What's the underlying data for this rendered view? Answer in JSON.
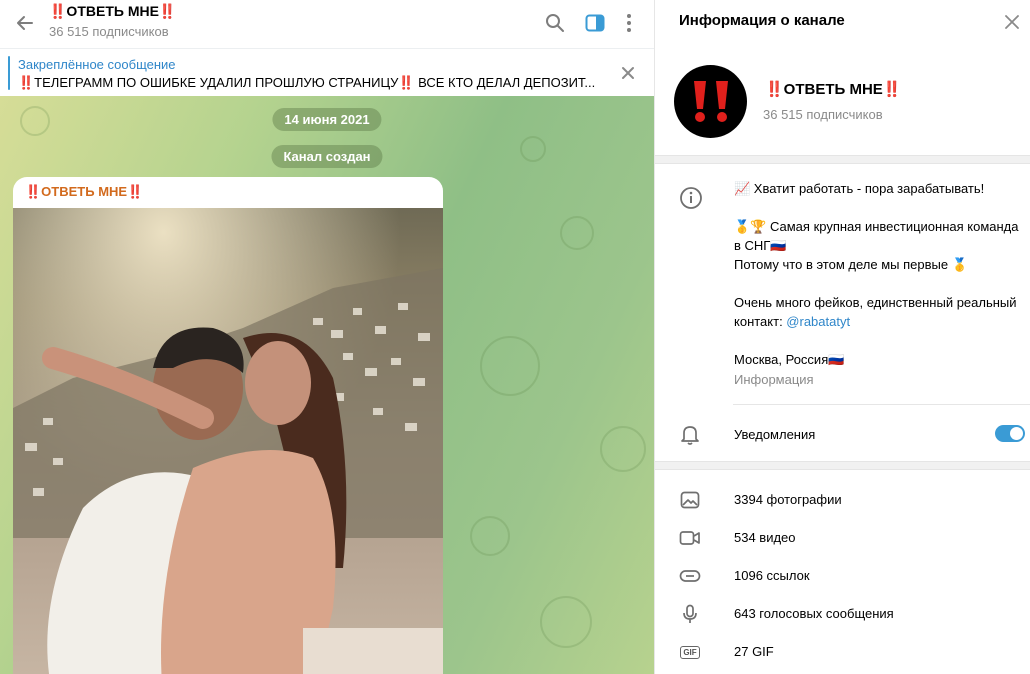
{
  "header": {
    "title": "‼️ОТВЕТЬ МНЕ‼️",
    "subscribers": "36 515 подписчиков"
  },
  "pinned": {
    "label": "Закреплённое сообщение",
    "text": "‼️ТЕЛЕГРАММ ПО ОШИБКЕ УДАЛИЛ ПРОШЛУЮ СТРАНИЦУ‼️  ВСЕ КТО ДЕЛАЛ ДЕПОЗИТ..."
  },
  "chat": {
    "date_pill": "14 июня 2021",
    "service_pill": "Канал создан",
    "message_author": "‼️ОТВЕТЬ МНЕ‼️"
  },
  "info": {
    "panel_title": "Информация о канале",
    "channel_name": "‼️ОТВЕТЬ МНЕ‼️",
    "subscribers": "36 515 подписчиков",
    "description": [
      "📈 Хватит работать - пора зарабатывать!",
      "",
      "🥇🏆 Самая крупная инвестиционная команда в СНГ🇷🇺",
      "Потому что в этом деле мы первые 🥇",
      "",
      "Очень много фейков, единственный реальный контакт: ",
      "",
      "Москва, Россия🇷🇺"
    ],
    "contact_link": "@rabatatyt",
    "description_caption": "Информация",
    "notifications_label": "Уведомления",
    "notifications_on": true,
    "media": [
      {
        "icon": "photo-icon",
        "label": "3394 фотографии"
      },
      {
        "icon": "video-icon",
        "label": "534 видео"
      },
      {
        "icon": "link-icon",
        "label": "1096 ссылок"
      },
      {
        "icon": "microphone-icon",
        "label": "643 голосовых сообщения"
      },
      {
        "icon": "gif-icon",
        "label": "27 GIF",
        "badge": "GIF"
      }
    ]
  },
  "colors": {
    "accent": "#3a9bd5",
    "link": "#2f86c9",
    "author": "#d26a1d",
    "avatar_mark": "#e0201c"
  }
}
